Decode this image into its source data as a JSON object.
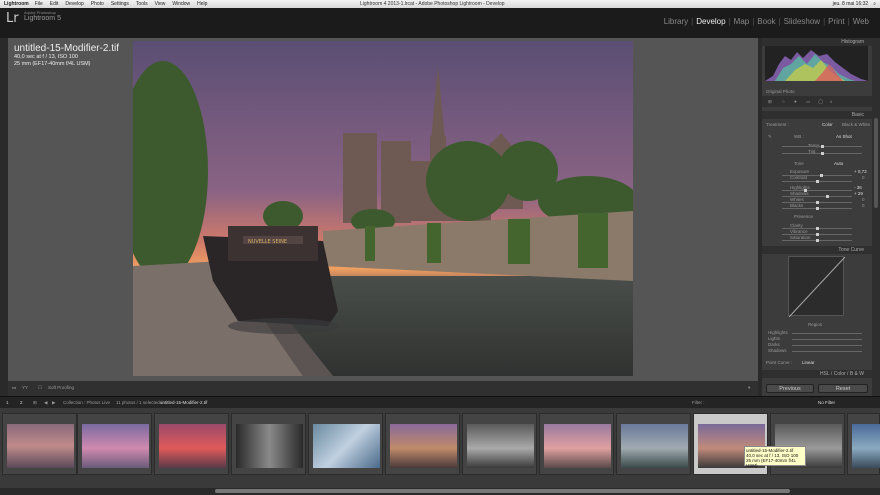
{
  "menubar": {
    "app": "Lightroom",
    "items": [
      "File",
      "Edit",
      "Develop",
      "Photo",
      "Settings",
      "Tools",
      "View",
      "Window",
      "Help"
    ],
    "window_title": "Lightroom 4 2013-1.lrcat - Adobe Photoshop Lightroom - Develop",
    "clock": "jeu. 8 mai 16:32"
  },
  "identity": {
    "logo": "Lr",
    "line1": "Adobe Photoshop",
    "line2": "Lightroom 5"
  },
  "modules": [
    {
      "label": "Library",
      "active": false
    },
    {
      "label": "Develop",
      "active": true
    },
    {
      "label": "Map",
      "active": false
    },
    {
      "label": "Book",
      "active": false
    },
    {
      "label": "Slideshow",
      "active": false
    },
    {
      "label": "Print",
      "active": false
    },
    {
      "label": "Web",
      "active": false
    }
  ],
  "info_overlay": {
    "filename": "untitled-15-Modifier-2.tif",
    "exposure": "40,0 sec at f / 13, ISO 100",
    "lens": "25 mm (EF17-40mm f/4L USM)"
  },
  "right_panel": {
    "histogram_label": "Histogram",
    "original_photo": "Original Photo",
    "basic_label": "Basic",
    "treatment": "Treatment :",
    "color": "Color",
    "bw": "Black & White",
    "wb": "WB :",
    "as_shot": "As Shot",
    "temp": "Temp",
    "tint": "Tint",
    "tone": "Tone",
    "auto": "Auto",
    "exposure": "Exposure",
    "exposure_val": "+ 0,73",
    "contrast": "Contrast",
    "contrast_val": "0",
    "highlights": "Highlights",
    "highlights_val": "- 36",
    "shadows": "Shadows",
    "shadows_val": "+ 29",
    "whites": "Whites",
    "whites_val": "0",
    "blacks": "Blacks",
    "blacks_val": "0",
    "presence": "Presence",
    "clarity": "Clarity",
    "vibrance": "Vibrance",
    "saturation": "Saturation",
    "tone_curve": "Tone Curve",
    "region": "Region",
    "r_highlights": "Highlights",
    "r_lights": "Lights",
    "r_darks": "Darks",
    "r_shadows": "Shadows",
    "point_curve": "Point Curve :",
    "linear": "Linear",
    "hsl": "HSL / Color / B & W",
    "previous": "Previous",
    "reset": "Reset"
  },
  "toolbar": {
    "soft_proofing": "Soft Proofing"
  },
  "filmstrip_bar": {
    "pages": [
      "1",
      "2"
    ],
    "collection": "Collection : Photos Live",
    "count": "11 photos / 1 selected /",
    "current": "untitled-15-Modifier-2.tif",
    "filter": "Filter :",
    "no_filter": "No Filter"
  },
  "tooltip": {
    "filename": "untitled-15-Modifier-2.tif",
    "exposure": "40,0 sec at f / 13, ISO 100",
    "lens": "25 mm (EF17-40mm f/4L USM)"
  }
}
